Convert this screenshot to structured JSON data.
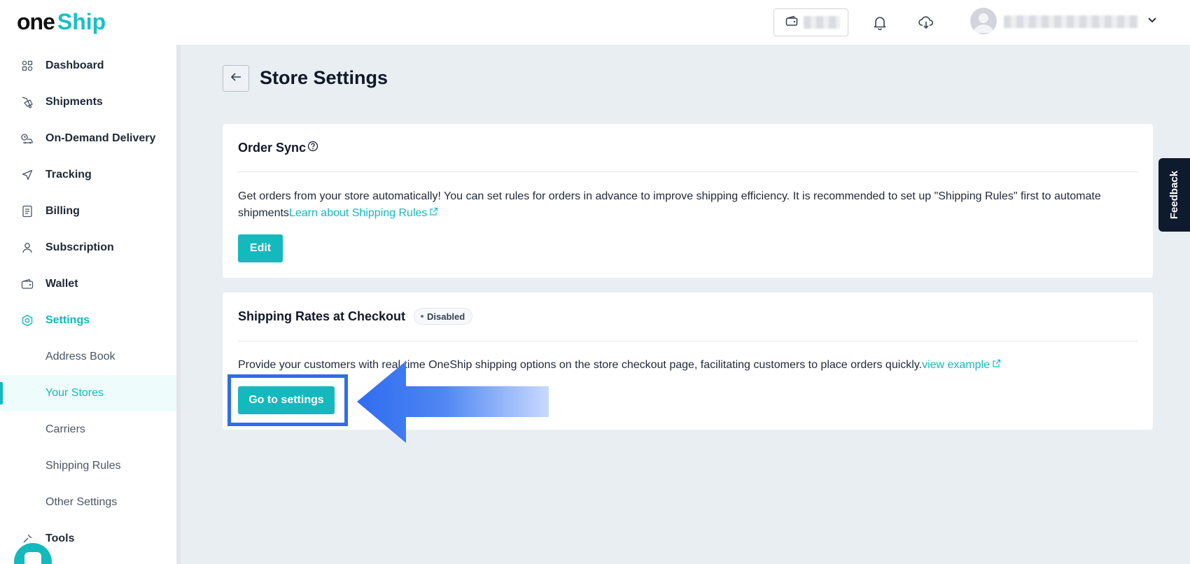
{
  "header": {
    "logo_part1": "one",
    "logo_part2": "Ship"
  },
  "sidebar": {
    "items": [
      {
        "label": "Dashboard",
        "icon": "dashboard-icon"
      },
      {
        "label": "Shipments",
        "icon": "shipments-icon"
      },
      {
        "label": "On-Demand Delivery",
        "icon": "delivery-icon"
      },
      {
        "label": "Tracking",
        "icon": "tracking-icon"
      },
      {
        "label": "Billing",
        "icon": "billing-icon"
      },
      {
        "label": "Subscription",
        "icon": "subscription-icon"
      },
      {
        "label": "Wallet",
        "icon": "wallet-icon"
      },
      {
        "label": "Settings",
        "icon": "settings-icon"
      },
      {
        "label": "Address Book"
      },
      {
        "label": "Your Stores"
      },
      {
        "label": "Carriers"
      },
      {
        "label": "Shipping Rules"
      },
      {
        "label": "Other Settings"
      },
      {
        "label": "Tools",
        "icon": "tools-icon"
      }
    ]
  },
  "page": {
    "title": "Store Settings"
  },
  "order_sync": {
    "title": "Order Sync",
    "description": "Get orders from your store automatically! You can set rules for orders in advance to improve shipping efficiency. It is recommended to set up \"Shipping Rules\" first to automate shipments",
    "link": "Learn about Shipping Rules",
    "button": "Edit"
  },
  "shipping_rates": {
    "title": "Shipping Rates at Checkout",
    "badge": "Disabled",
    "description": "Provide your customers with real-time OneShip shipping options on the store checkout page, facilitating customers to place orders quickly.",
    "link": "view example",
    "button": "Go to settings"
  },
  "feedback": {
    "label": "Feedback"
  },
  "colors": {
    "brand": "#13b9bd",
    "highlight": "#2f6cf0",
    "background": "#e9eef3"
  }
}
